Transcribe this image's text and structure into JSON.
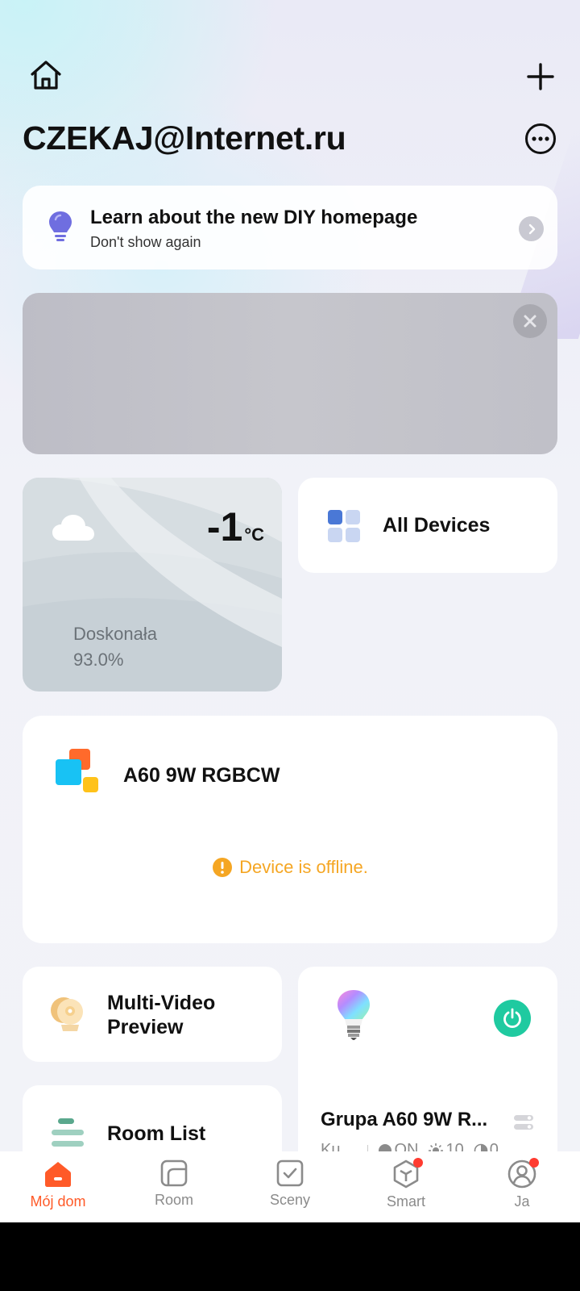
{
  "header": {
    "home_icon": "home-icon",
    "add_icon": "plus-icon",
    "title": "CZEKAJ@Internet.ru",
    "more_icon": "more-dots-icon"
  },
  "tip_card": {
    "title": "Learn about the new DIY homepage",
    "subtitle": "Don't show again",
    "icon": "lightbulb-icon",
    "chevron_icon": "chevron-right-icon"
  },
  "banner": {
    "close_icon": "close-icon"
  },
  "weather": {
    "temperature": "-1",
    "unit": "°C",
    "condition": "Doskonała",
    "humidity": "93.0%",
    "icon": "cloud-icon"
  },
  "all_devices": {
    "label": "All Devices",
    "icon": "grid-icon"
  },
  "device_card": {
    "name": "A60  9W RGBCW",
    "status": "Device is offline.",
    "status_color": "#f5a623",
    "icon": "color-squares-icon"
  },
  "multi_video": {
    "label": "Multi-Video Preview",
    "icon": "camera-icon"
  },
  "room_list": {
    "label": "Room List",
    "icon": "list-lines-icon"
  },
  "group_card": {
    "name": "Grupa A60  9W R...",
    "room_prefix": "Ku",
    "power_state": "ON",
    "brightness": "10",
    "saturation": "0",
    "icon": "rgb-bulb-icon",
    "power_icon": "power-icon",
    "settings_icon": "toggle-icon",
    "accent": "#1fcaa0"
  },
  "nav": {
    "items": [
      {
        "label": "Mój dom",
        "icon": "home-filled-icon",
        "active": true
      },
      {
        "label": "Room",
        "icon": "room-icon",
        "active": false
      },
      {
        "label": "Sceny",
        "icon": "checkbox-icon",
        "active": false
      },
      {
        "label": "Smart",
        "icon": "cube-icon",
        "active": false,
        "badge": true
      },
      {
        "label": "Ja",
        "icon": "user-icon",
        "active": false,
        "badge": true
      }
    ]
  },
  "colors": {
    "accent_orange": "#ff5a28",
    "inactive": "#8b8b8b"
  }
}
